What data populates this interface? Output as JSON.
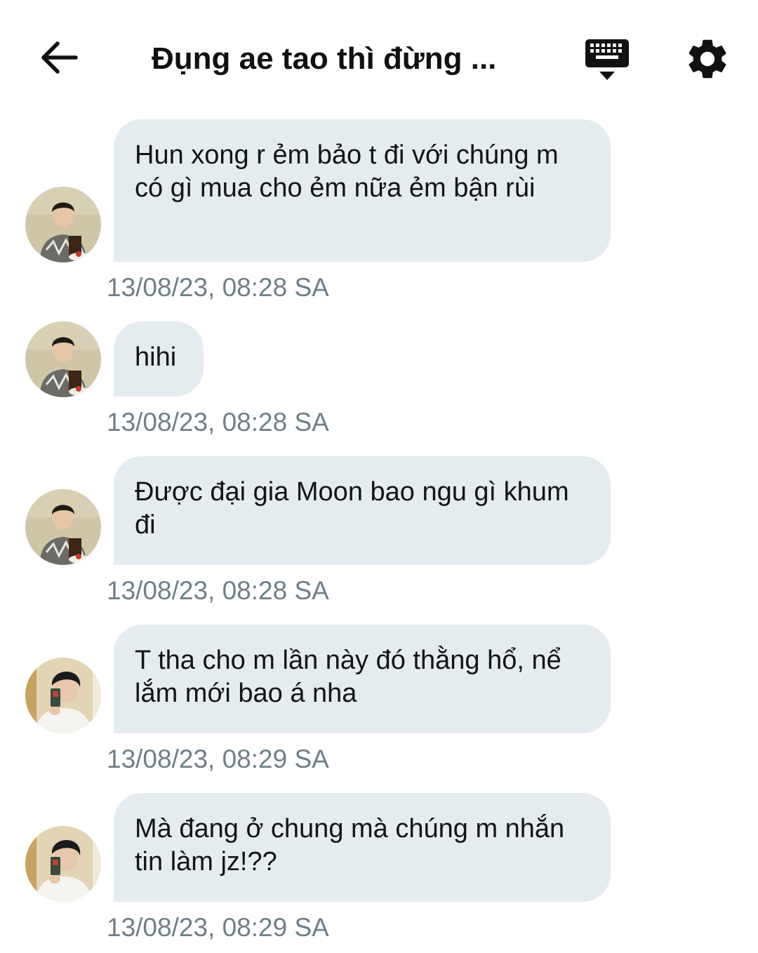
{
  "header": {
    "title": "Đụng ae tao thì đừng ...",
    "back_icon": "arrow-left-icon",
    "keyboard_icon": "keyboard-hide-icon",
    "settings_icon": "gear-icon"
  },
  "colors": {
    "bubble": "#e4ecef",
    "timestamp": "#6f7f89",
    "text": "#141414"
  },
  "messages": [
    {
      "sender_avatar": "avatar-user-a",
      "text": "Hun xong r ẻm bảo t đi với chúng m có gì mua cho ẻm nữa ẻm bận rùi",
      "time": "13/08/23, 08:28 SA"
    },
    {
      "sender_avatar": "avatar-user-a",
      "text": "hihi",
      "time": "13/08/23, 08:28 SA"
    },
    {
      "sender_avatar": "avatar-user-a",
      "text": "Được đại gia Moon bao ngu gì khum đi",
      "time": "13/08/23, 08:28 SA"
    },
    {
      "sender_avatar": "avatar-user-b",
      "text": "T tha cho m lần này đó thằng hổ, nể lắm mới bao á nha",
      "time": "13/08/23, 08:29 SA"
    },
    {
      "sender_avatar": "avatar-user-b",
      "text": "Mà đang ở chung mà chúng m nhắn tin làm jz!??",
      "time": "13/08/23, 08:29 SA"
    }
  ]
}
